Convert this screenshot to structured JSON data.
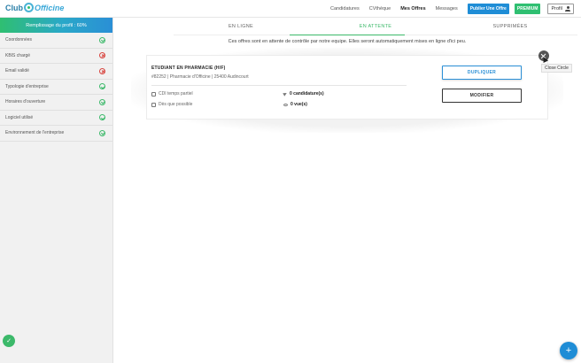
{
  "header": {
    "logo_part1": "Club",
    "logo_part2": "Officine",
    "nav": [
      "Candidatures",
      "CVthèque",
      "Mes Offres",
      "Messages"
    ],
    "publish_label": "Publier Une Offre",
    "premium_label": "PREMIUM",
    "profile_label": "Profil"
  },
  "sidebar": {
    "banner": "Remplissage du profil : 60%",
    "items": [
      {
        "label": "Coordonnées",
        "status": "ok"
      },
      {
        "label": "KBIS chargé",
        "status": "missing"
      },
      {
        "label": "Email validé",
        "status": "missing"
      },
      {
        "label": "Typologie d'entreprise",
        "status": "ok"
      },
      {
        "label": "Horaires d'ouverture",
        "status": "ok"
      },
      {
        "label": "Logiciel utilisé",
        "status": "ok"
      },
      {
        "label": "Environnement de l'entreprise",
        "status": "ok"
      }
    ]
  },
  "tabs": [
    "EN LIGNE",
    "EN ATTENTE",
    "SUPPRIMÉES"
  ],
  "active_tab": "EN ATTENTE",
  "notice": "Ces offres sont en attente de contrôle par notre equipe. Elles seront automatiquement mises en ligne d'ici peu.",
  "offer": {
    "title": "ETUDIANT EN PHARMACIE (H/F)",
    "subtitle": "#82252 | Pharmacie d'Officine | 25400 Audincourt",
    "contract": "CDI temps partiel",
    "start": "Dès que possible",
    "applications": "0 candidature(s)",
    "views": "0 vue(s)",
    "duplicate_label": "DUPLIQUER",
    "edit_label": "MODIFIER"
  },
  "tooltip": "Close Circle",
  "fab_label": "+",
  "side_fab_label": "✓"
}
